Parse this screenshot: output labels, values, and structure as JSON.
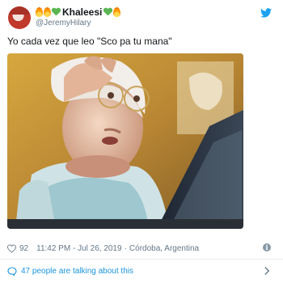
{
  "user": {
    "display_name": "Khaleesi",
    "handle": "@JeremyHilary",
    "name_emojis": [
      "fire-emoji",
      "green-heart-emoji",
      "green-heart-emoji",
      "fire-emoji"
    ]
  },
  "tweet": {
    "text": "Yo cada vez que leo \"Sco pa tu mana\"",
    "likes": "92",
    "time": "11:42 PM - Jul 26, 2019",
    "separator": "·",
    "location": "Córdoba, Argentina"
  },
  "conversation": {
    "label": "47 people are talking about this"
  },
  "icons": {
    "brand": "twitter-bird-icon",
    "like": "heart-outline-icon",
    "info": "info-icon",
    "talk": "speech-bubble-icon",
    "chevron": "chevron-right-icon"
  },
  "colors": {
    "accent": "#1b95e0",
    "text": "#14171a",
    "muted": "#657786",
    "divider": "#e6ecf0"
  }
}
